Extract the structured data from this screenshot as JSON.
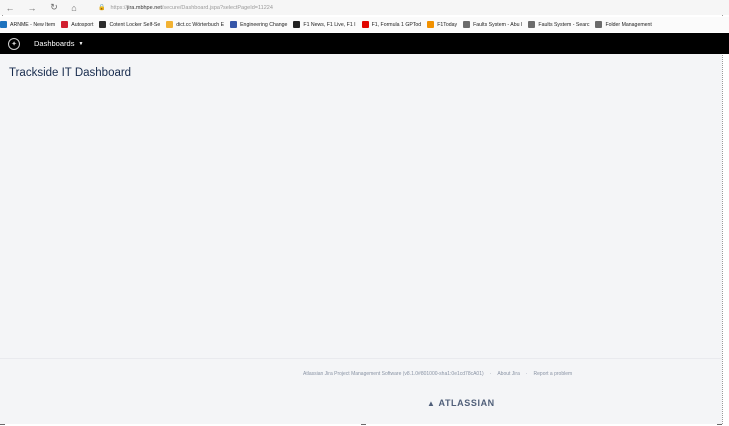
{
  "browser": {
    "back_icon": "back-arrow-icon",
    "forward_icon": "forward-arrow-icon",
    "reload_icon": "reload-icon",
    "home_icon": "home-icon",
    "url_prefix": "https://",
    "url_host": "jira.mbhpe.net",
    "url_path": "/secure/Dashboard.jspa?selectPageId=11224"
  },
  "bookmarks": [
    {
      "label": "ARNME - New Item",
      "color": "#1e73be"
    },
    {
      "label": "Autosport",
      "color": "#d11f2f"
    },
    {
      "label": "Cotent Locker Self-Se",
      "color": "#2b2b2b"
    },
    {
      "label": "dict.cc Wörterbuch E",
      "color": "#f2b233"
    },
    {
      "label": "Engineering Change",
      "color": "#3656a8"
    },
    {
      "label": "F1 News, F1 Live, F1 I",
      "color": "#222222"
    },
    {
      "label": "F1, Formula 1 GPTod",
      "color": "#e10600"
    },
    {
      "label": "F1Today",
      "color": "#f29100"
    },
    {
      "label": "Faults System - Abu I",
      "color": "#6b6b6b"
    },
    {
      "label": "Faults System - Searc",
      "color": "#6b6b6b"
    },
    {
      "label": "Folder Management",
      "color": "#6b6b6b"
    }
  ],
  "header": {
    "menu_label": "Dashboards",
    "bg": "#000000"
  },
  "main": {
    "title": "Trackside IT Dashboard"
  },
  "footer": {
    "software": "Atlassian Jira Project Management Software (v8.1.0#801000-sha1:0e1cd78cA01)",
    "about": "About Jira",
    "report": "Report a problem",
    "brand": "ATLASSIAN"
  }
}
